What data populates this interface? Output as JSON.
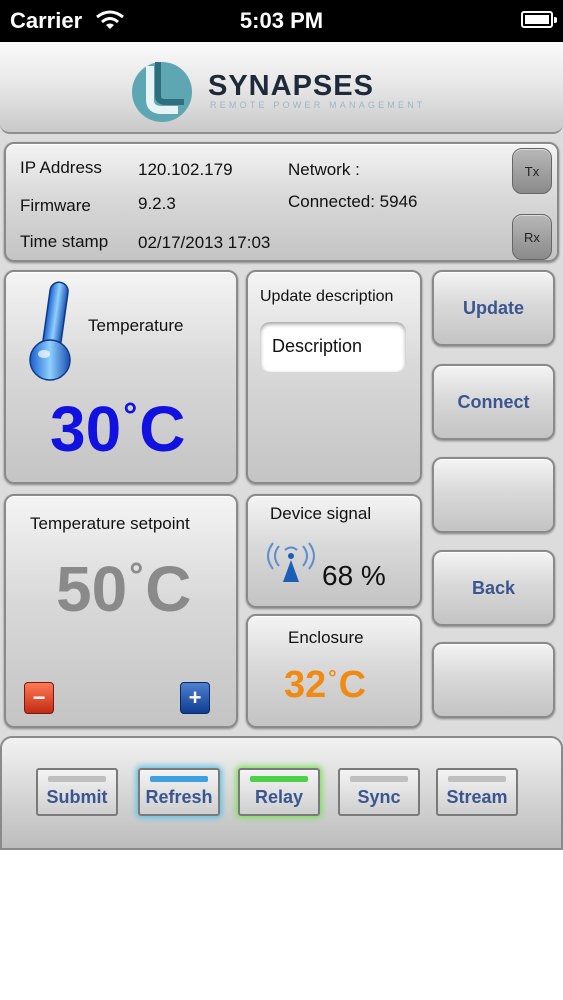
{
  "status_bar": {
    "carrier": "Carrier",
    "time": "5:03 PM"
  },
  "header": {
    "logo_name": "SYNAPSES",
    "logo_tagline": "REMOTE POWER MANAGEMENT"
  },
  "device_info": {
    "ip_label": "IP Address",
    "ip_value": "120.102.179",
    "firmware_label": "Firmware",
    "firmware_value": "9.2.3",
    "timestamp_label": "Time stamp",
    "timestamp_value": "02/17/2013 17:03",
    "network_label": "Network :",
    "connected_text": "Connected: 5946",
    "tx_label": "Tx",
    "rx_label": "Rx"
  },
  "temperature": {
    "title": "Temperature",
    "value": "30",
    "unit": "C",
    "degree": "°",
    "color": "#1212e0"
  },
  "update": {
    "title": "Update description",
    "field_value": "Description"
  },
  "side_buttons": {
    "update": "Update",
    "connect": "Connect",
    "blank1": "",
    "back": "Back",
    "blank2": ""
  },
  "setpoint": {
    "title": "Temperature setpoint",
    "value": "50",
    "unit": "C",
    "degree": "°",
    "color": "#8a8a8a",
    "minus": "−",
    "plus": "+"
  },
  "signal": {
    "title": "Device signal",
    "value": "68 %"
  },
  "enclosure": {
    "title": "Enclosure",
    "value": "32",
    "unit": "C",
    "degree": "°",
    "color": "#f08a12"
  },
  "bottom_tabs": {
    "submit": "Submit",
    "refresh": "Refresh",
    "relay": "Relay",
    "sync": "Sync",
    "stream": "Stream"
  },
  "colors": {
    "button_text": "#3b5590",
    "highlight_blue": "#3fa0e0",
    "highlight_green": "#4fd04a"
  }
}
